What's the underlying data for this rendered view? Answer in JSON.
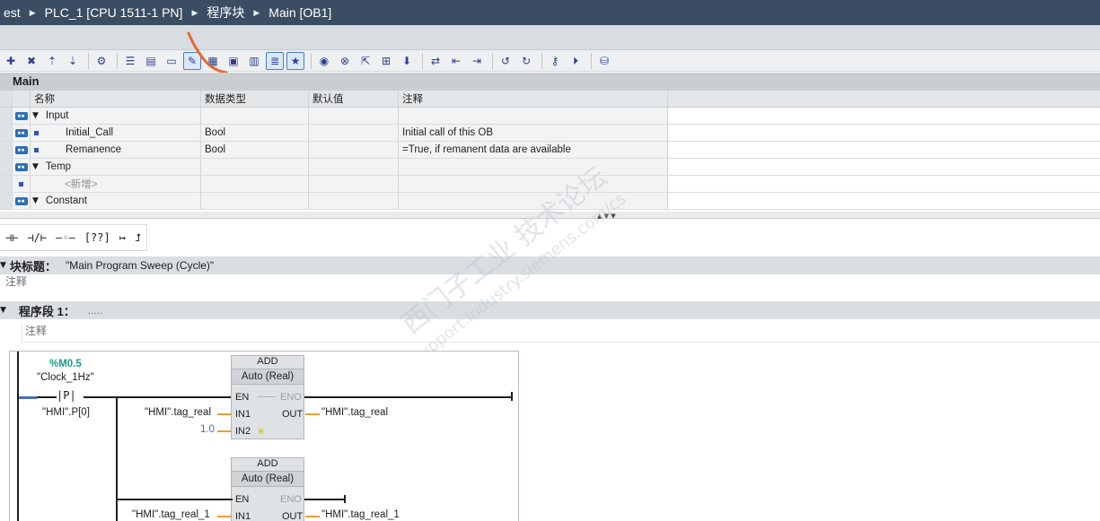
{
  "breadcrumb": [
    "est",
    "PLC_1 [CPU 1511-1 PN]",
    "程序块",
    "Main [OB1]"
  ],
  "toolbar": {
    "icons": [
      "insert-row-icon",
      "delete-row-icon",
      "move-up-icon",
      "move-down-icon",
      "network-settings-icon",
      "expand-icon",
      "collapse-icon",
      "view-icon",
      "comment-toggle-icon",
      "absolute-operand-icon",
      "favorites-icon",
      "abs-display-icon",
      "tag-info-icon",
      "show-favorites-icon",
      "breakpoint-icon",
      "clear-icon",
      "goto-icon",
      "monitor-icon",
      "status-icon",
      "compare-icon",
      "prev-error-icon",
      "next-error-icon",
      "update-icon",
      "refresh-icon",
      "monitor-on-icon",
      "monitor-modify-icon",
      "database-icon"
    ]
  },
  "interface": {
    "title": "Main",
    "columns": [
      "名称",
      "数据类型",
      "默认值",
      "注释"
    ],
    "rows": [
      {
        "kind": "section",
        "name": "Input",
        "type": "",
        "default": "",
        "comment": ""
      },
      {
        "kind": "param",
        "name": "Initial_Call",
        "type": "Bool",
        "default": "",
        "comment": "Initial call of this OB"
      },
      {
        "kind": "param",
        "name": "Remanence",
        "type": "Bool",
        "default": "",
        "comment": "=True, if remanent data are available"
      },
      {
        "kind": "section",
        "name": "Temp",
        "type": "",
        "default": "",
        "comment": ""
      },
      {
        "kind": "new",
        "name": "<新增>",
        "type": "",
        "default": "",
        "comment": ""
      },
      {
        "kind": "section",
        "name": "Constant",
        "type": "",
        "default": "",
        "comment": ""
      }
    ]
  },
  "lad_buttons": [
    "⊣⊢",
    "⊣/⊢",
    "–◦–",
    "[??]",
    "↦",
    "⮥"
  ],
  "block": {
    "title_label": "块标题：",
    "title_value": "\"Main Program Sweep (Cycle)\"",
    "comment": "注释"
  },
  "network": {
    "label": "程序段 1：",
    "dots": ".....",
    "comment": "注释",
    "contact": {
      "address": "%M0.5",
      "symbol": "\"Clock_1Hz\"",
      "type": "P",
      "edge_bit": "\"HMI\".P[0]"
    },
    "boxes": [
      {
        "name": "ADD",
        "type": "Auto (Real)",
        "en": "EN",
        "eno": "ENO",
        "in1_label": "IN1",
        "in2_label": "IN2",
        "out_label": "OUT",
        "in1": "\"HMI\".tag_real",
        "in2": "1.0",
        "out": "\"HMI\".tag_real",
        "star": "✳"
      },
      {
        "name": "ADD",
        "type": "Auto (Real)",
        "en": "EN",
        "eno": "ENO",
        "in1_label": "IN1",
        "in2_label": "",
        "out_label": "OUT",
        "in1": "\"HMI\".tag_real_1",
        "in2": "",
        "out": "\"HMI\".tag_real_1",
        "star": ""
      }
    ]
  },
  "watermark": {
    "cn": "西门子工业 技术论坛",
    "en": "support.industry.siemens.com/cs"
  }
}
